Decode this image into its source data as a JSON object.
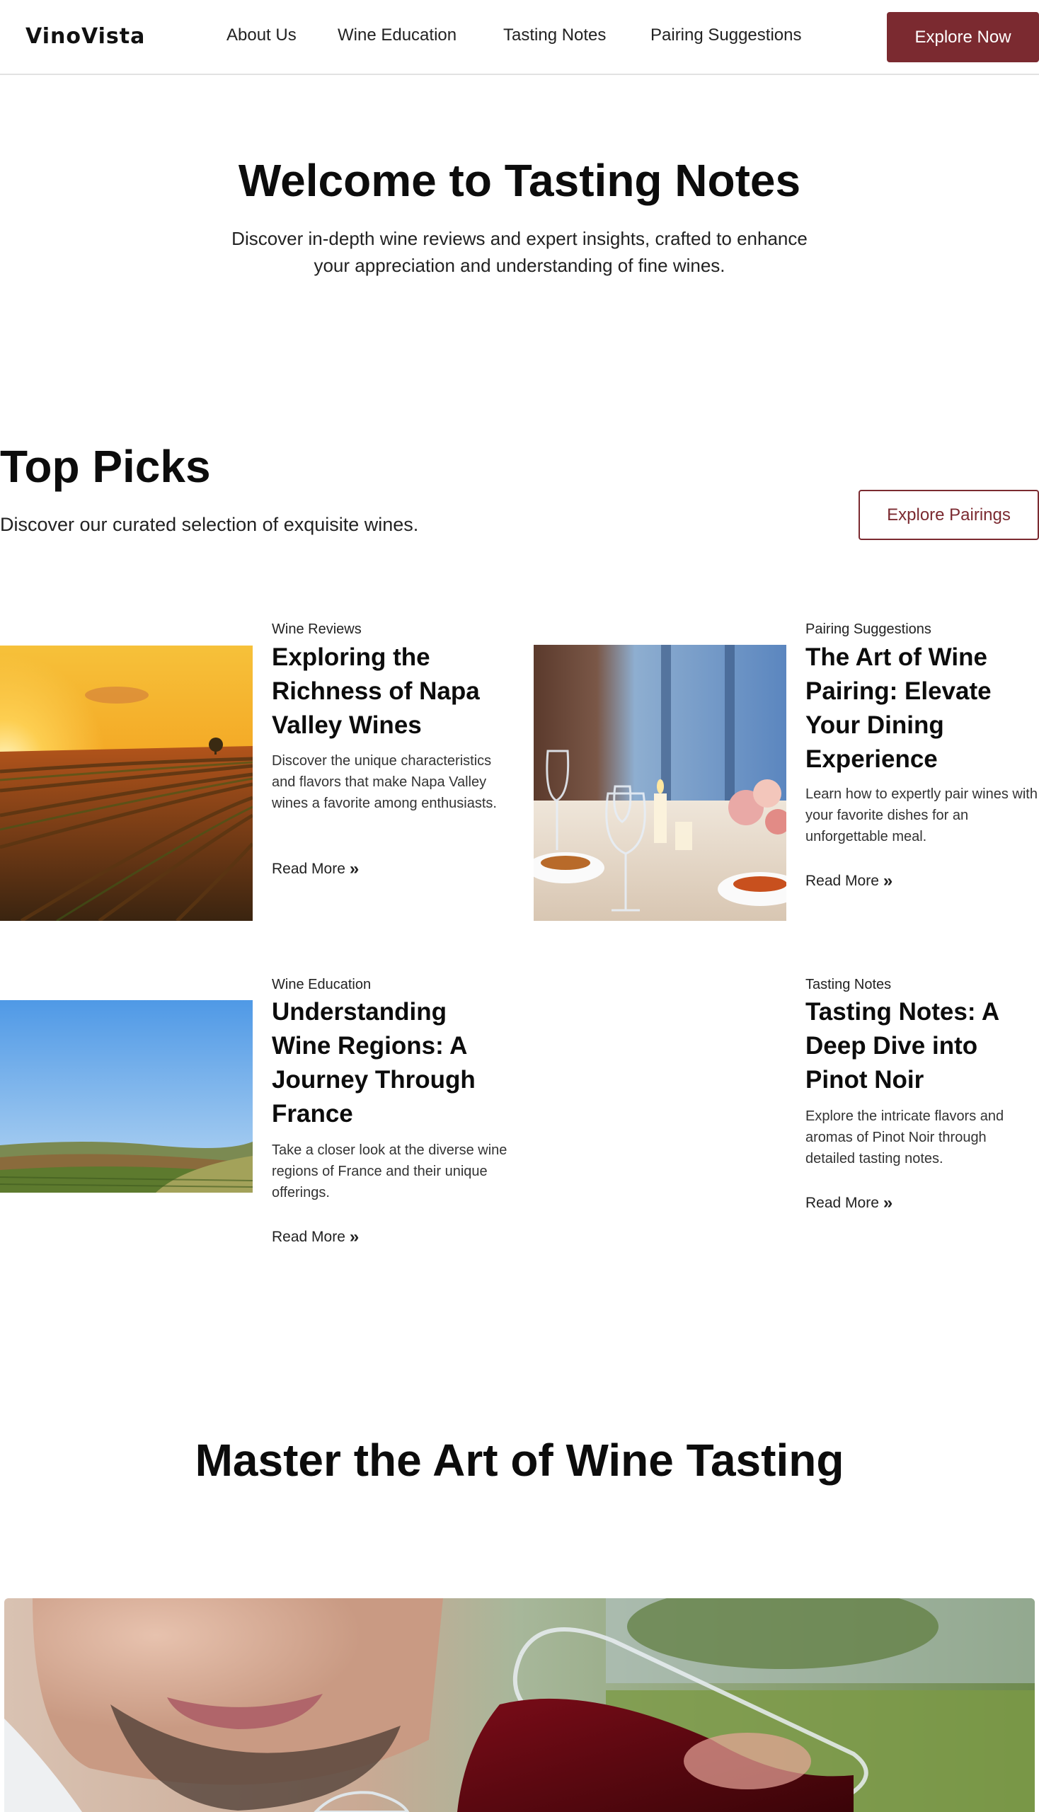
{
  "header": {
    "logo": "VinoVista",
    "nav": [
      "About Us",
      "Wine Education",
      "Tasting Notes",
      "Pairing Suggestions"
    ],
    "cta": "Explore Now"
  },
  "hero": {
    "title": "Welcome to Tasting Notes",
    "subtitle": "Discover in-depth wine reviews and expert insights, crafted to enhance your appreciation and understanding of fine wines."
  },
  "top_picks": {
    "title": "Top Picks",
    "subtitle": "Discover our curated selection of exquisite wines.",
    "button": "Explore Pairings",
    "read_more": "Read More",
    "cards": [
      {
        "category": "Wine Reviews",
        "title": "Exploring the Richness of Napa Valley Wines",
        "description": "Discover the unique characteristics and flavors that make Napa Valley wines a favorite among enthusiasts.",
        "image": "vineyard-sunset"
      },
      {
        "category": "Pairing Suggestions",
        "title": "The Art of Wine Pairing: Elevate Your Dining Experience",
        "description": "Learn how to expertly pair wines with your favorite dishes for an unforgettable meal.",
        "image": "dining-table-wine-glasses"
      },
      {
        "category": "Wine Education",
        "title": "Understanding Wine Regions: A Journey Through France",
        "description": "Take a closer look at the diverse wine regions of France and their unique offerings.",
        "image": "french-countryside"
      },
      {
        "category": "Tasting Notes",
        "title": "Tasting Notes: A Deep Dive into Pinot Noir",
        "description": "Explore the intricate flavors and aromas of Pinot Noir through detailed tasting notes.",
        "image": ""
      }
    ]
  },
  "master": {
    "title": "Master the Art of Wine Tasting",
    "image": "man-pouring-red-wine"
  },
  "colors": {
    "brand": "#7b2a30",
    "text": "#0c0c0c",
    "divider": "#e2e2e2"
  }
}
